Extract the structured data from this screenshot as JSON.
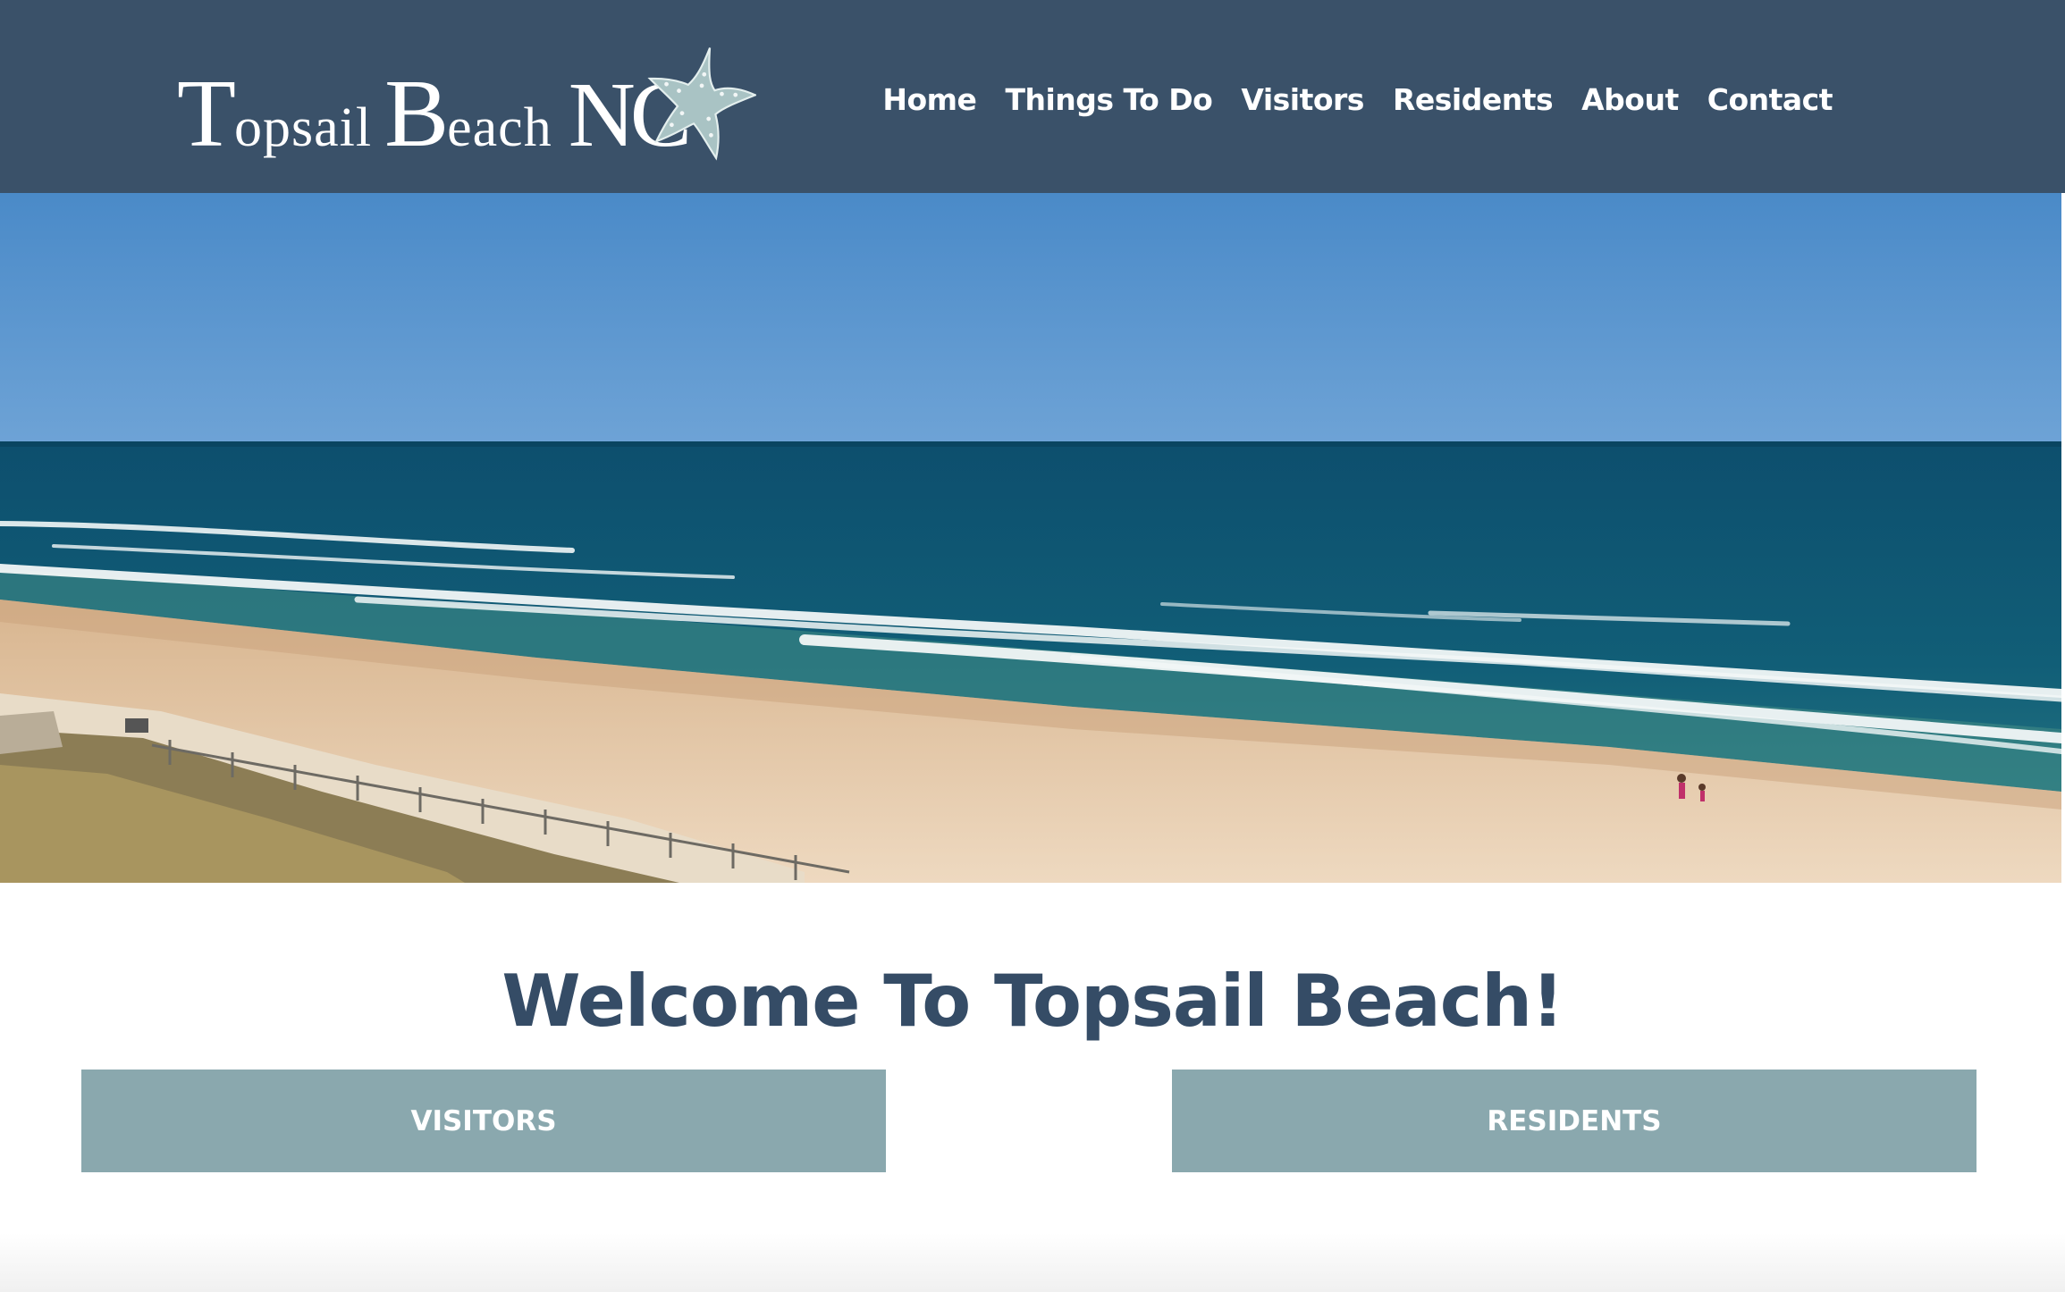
{
  "header": {
    "logo": {
      "b1": "T",
      "w1": "opsail",
      "b2": "B",
      "w2": "each",
      "nc": "NC",
      "icon": "starfish-icon"
    },
    "nav": [
      "Home",
      "Things To Do",
      "Visitors",
      "Residents",
      "About",
      "Contact"
    ]
  },
  "hero": {
    "icon": "beach-photo"
  },
  "main": {
    "title": "Welcome To Topsail Beach!",
    "buttons": {
      "visitors": "VISITORS",
      "residents": "RESIDENTS"
    }
  },
  "colors": {
    "header_bg": "#3a5169",
    "title": "#354c66",
    "button_bg": "#8aa8ae"
  }
}
